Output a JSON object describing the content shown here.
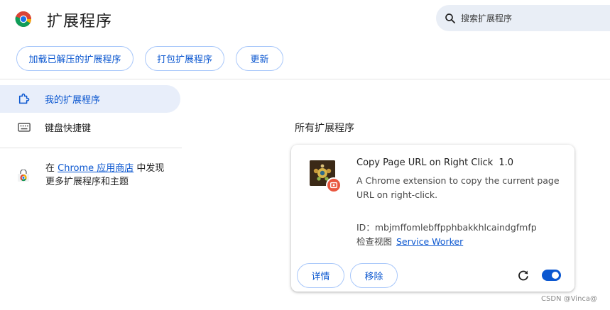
{
  "header": {
    "title": "扩展程序",
    "search_placeholder": "搜索扩展程序"
  },
  "toolbar": {
    "load_unpacked": "加载已解压的扩展程序",
    "pack": "打包扩展程序",
    "update": "更新"
  },
  "sidebar": {
    "items": [
      {
        "label": "我的扩展程序"
      },
      {
        "label": "键盘快捷键"
      }
    ],
    "store": {
      "prefix": "在",
      "link": "Chrome 应用商店",
      "suffix": "中发现",
      "line2": "更多扩展程序和主题"
    }
  },
  "main": {
    "section_title": "所有扩展程序",
    "extension": {
      "name": "Copy Page URL on Right Click",
      "version": "1.0",
      "description": "A Chrome extension to copy the current page URL on right-click.",
      "id_label": "ID：",
      "id": "mbjmffomlebffpphbakkhlcaindgfmfp",
      "inspect_label": "检查视图",
      "inspect_link": "Service Worker",
      "details_button": "详情",
      "remove_button": "移除",
      "enabled": true
    }
  },
  "watermark": "CSDN @Vinca@",
  "colors": {
    "accent": "#0b57d0",
    "active_bg": "#e8eefa",
    "search_bg": "#e9eef6",
    "button_border": "#a8c7fa"
  }
}
